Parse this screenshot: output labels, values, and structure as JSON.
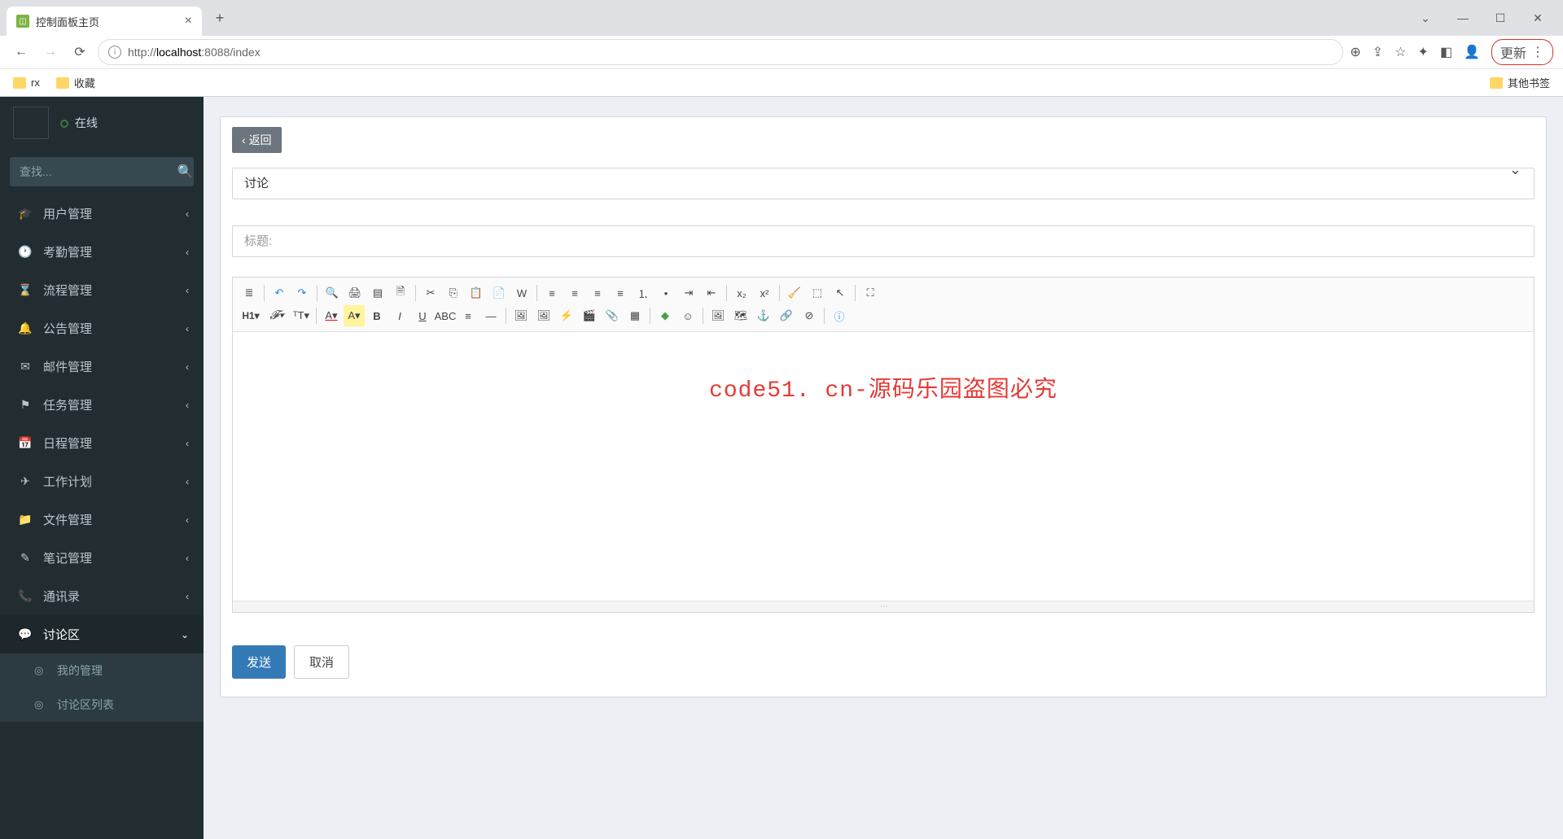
{
  "browser": {
    "tab_title": "控制面板主页",
    "url_host": "localhost",
    "url_port": ":8088",
    "url_path": "/index",
    "url_scheme": "http://",
    "update_label": "更新",
    "bookmarks": {
      "rx": "rx",
      "fav": "收藏",
      "other": "其他书签"
    }
  },
  "sidebar": {
    "status": "在线",
    "search_placeholder": "查找...",
    "items": [
      {
        "label": "用户管理",
        "icon": "🎓"
      },
      {
        "label": "考勤管理",
        "icon": "🕐"
      },
      {
        "label": "流程管理",
        "icon": "⌛"
      },
      {
        "label": "公告管理",
        "icon": "🔔"
      },
      {
        "label": "邮件管理",
        "icon": "✉"
      },
      {
        "label": "任务管理",
        "icon": "⚑"
      },
      {
        "label": "日程管理",
        "icon": "📅"
      },
      {
        "label": "工作计划",
        "icon": "✈"
      },
      {
        "label": "文件管理",
        "icon": "📁"
      },
      {
        "label": "笔记管理",
        "icon": "✎"
      },
      {
        "label": "通讯录",
        "icon": "📞"
      },
      {
        "label": "讨论区",
        "icon": "💬"
      }
    ],
    "sub": {
      "my_manage": "我的管理",
      "list": "讨论区列表"
    }
  },
  "form": {
    "back_label": "返回",
    "category_value": "讨论",
    "title_placeholder": "标题:",
    "watermark_text": "code51. cn-源码乐园盗图必究",
    "submit_label": "发送",
    "cancel_label": "取消"
  },
  "editor_toolbar": {
    "row1": [
      "source",
      "|",
      "undo",
      "redo",
      "|",
      "preview",
      "print",
      "template",
      "draft",
      "|",
      "cut",
      "copy",
      "paste",
      "paste-text",
      "paste-word",
      "|",
      "align-left",
      "align-center",
      "align-right",
      "align-justify",
      "ol",
      "ul",
      "indent",
      "outdent",
      "|",
      "sub",
      "sup",
      "|",
      "clean",
      "select-all",
      "cursor",
      "|",
      "fullscreen"
    ],
    "row2": [
      "H1",
      "font",
      "fontsize",
      "|",
      "forecolor",
      "bgcolor",
      "bold",
      "italic",
      "underline",
      "strike",
      "line",
      "hr",
      "|",
      "image",
      "multi-image",
      "flash",
      "media",
      "file",
      "table",
      "|",
      "code",
      "emoji",
      "|",
      "image2",
      "map",
      "anchor",
      "link",
      "unlink",
      "|",
      "about"
    ]
  }
}
